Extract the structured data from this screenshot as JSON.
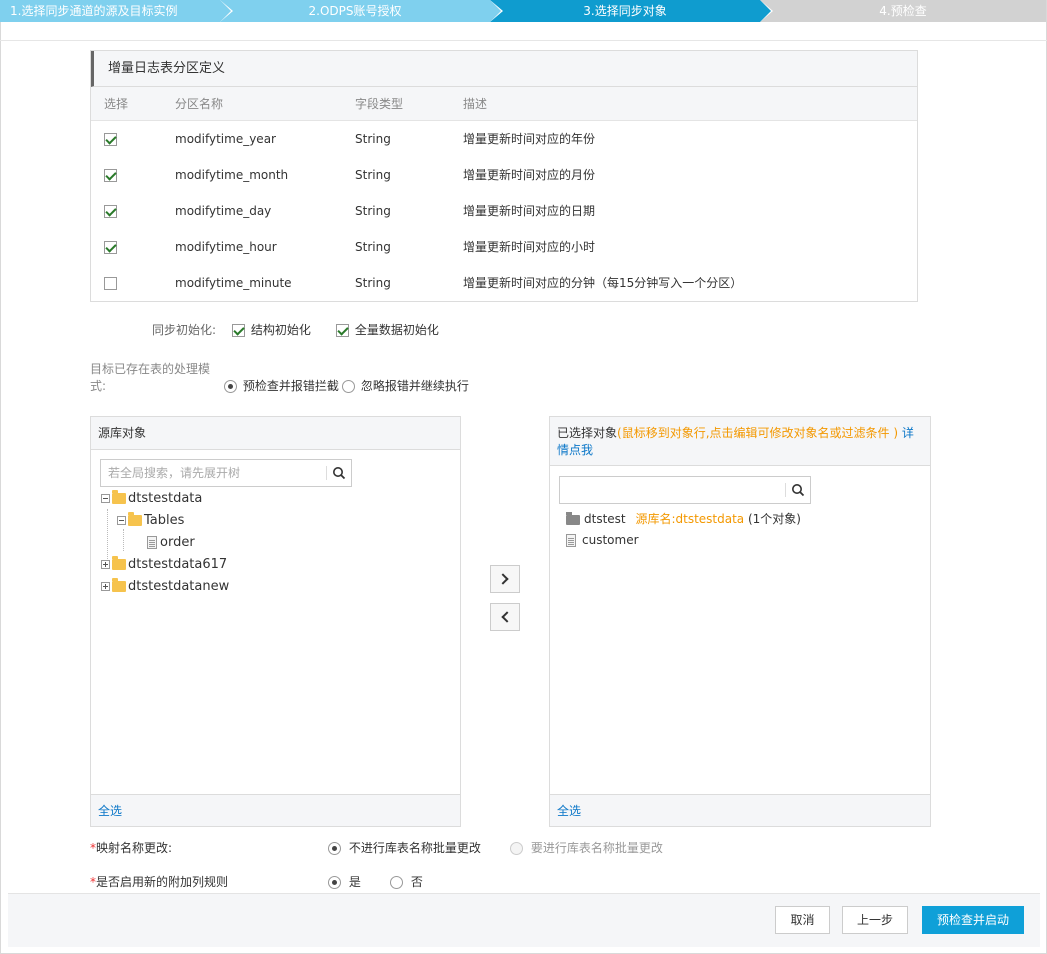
{
  "steps": [
    {
      "label": "1.选择同步通道的源及目标实例"
    },
    {
      "label": "2.ODPS账号授权"
    },
    {
      "label": "3.选择同步对象"
    },
    {
      "label": "4.预检查"
    }
  ],
  "partition": {
    "title": "增量日志表分区定义",
    "headers": {
      "select": "选择",
      "name": "分区名称",
      "type": "字段类型",
      "desc": "描述"
    },
    "rows": [
      {
        "checked": true,
        "name": "modifytime_year",
        "type": "String",
        "desc": "增量更新时间对应的年份"
      },
      {
        "checked": true,
        "name": "modifytime_month",
        "type": "String",
        "desc": "增量更新时间对应的月份"
      },
      {
        "checked": true,
        "name": "modifytime_day",
        "type": "String",
        "desc": "增量更新时间对应的日期"
      },
      {
        "checked": true,
        "name": "modifytime_hour",
        "type": "String",
        "desc": "增量更新时间对应的小时"
      },
      {
        "checked": false,
        "name": "modifytime_minute",
        "type": "String",
        "desc": "增量更新时间对应的分钟（每15分钟写入一个分区）"
      }
    ]
  },
  "sync_init": {
    "label": "同步初始化:",
    "struct": "结构初始化",
    "full": "全量数据初始化"
  },
  "existing_table": {
    "label_line1": "目标已存在表的处理模",
    "label_line2": "式:",
    "opt1": "预检查并报错拦截",
    "opt2": "忽略报错并继续执行"
  },
  "source_panel": {
    "title": "源库对象",
    "search_placeholder": "若全局搜索，请先展开树",
    "tree": {
      "db1": "dtstestdata",
      "tables": "Tables",
      "order": "order",
      "db2": "dtstestdata617",
      "db3": "dtstestdatanew"
    },
    "select_all": "全选"
  },
  "selected_panel": {
    "title": "已选择对象",
    "hint": "(鼠标移到对象行,点击编辑可修改对象名或过滤条件 )",
    "link_part1": "详",
    "link_part2": "情点我",
    "db_name": "dtstest",
    "db_source": "源库名:dtstestdata",
    "db_count": "(1个对象)",
    "table": "customer",
    "select_all": "全选"
  },
  "mapping": {
    "required_mark": "*",
    "label": "映射名称更改:",
    "opt1": "不进行库表名称批量更改",
    "opt2": "要进行库表名称批量更改"
  },
  "extra_columns": {
    "required_mark": "*",
    "label": "是否启用新的附加列规则",
    "yes": "是",
    "no": "否"
  },
  "buttons": {
    "cancel": "取消",
    "prev": "上一步",
    "start": "预检查并启动"
  },
  "colors": {
    "step_done": "#7fd0ee",
    "step_active": "#0f9ccf",
    "step_todo": "#d2d2d2",
    "primary": "#0fa0d8",
    "link": "#0c77c8",
    "hint": "#f39800"
  }
}
